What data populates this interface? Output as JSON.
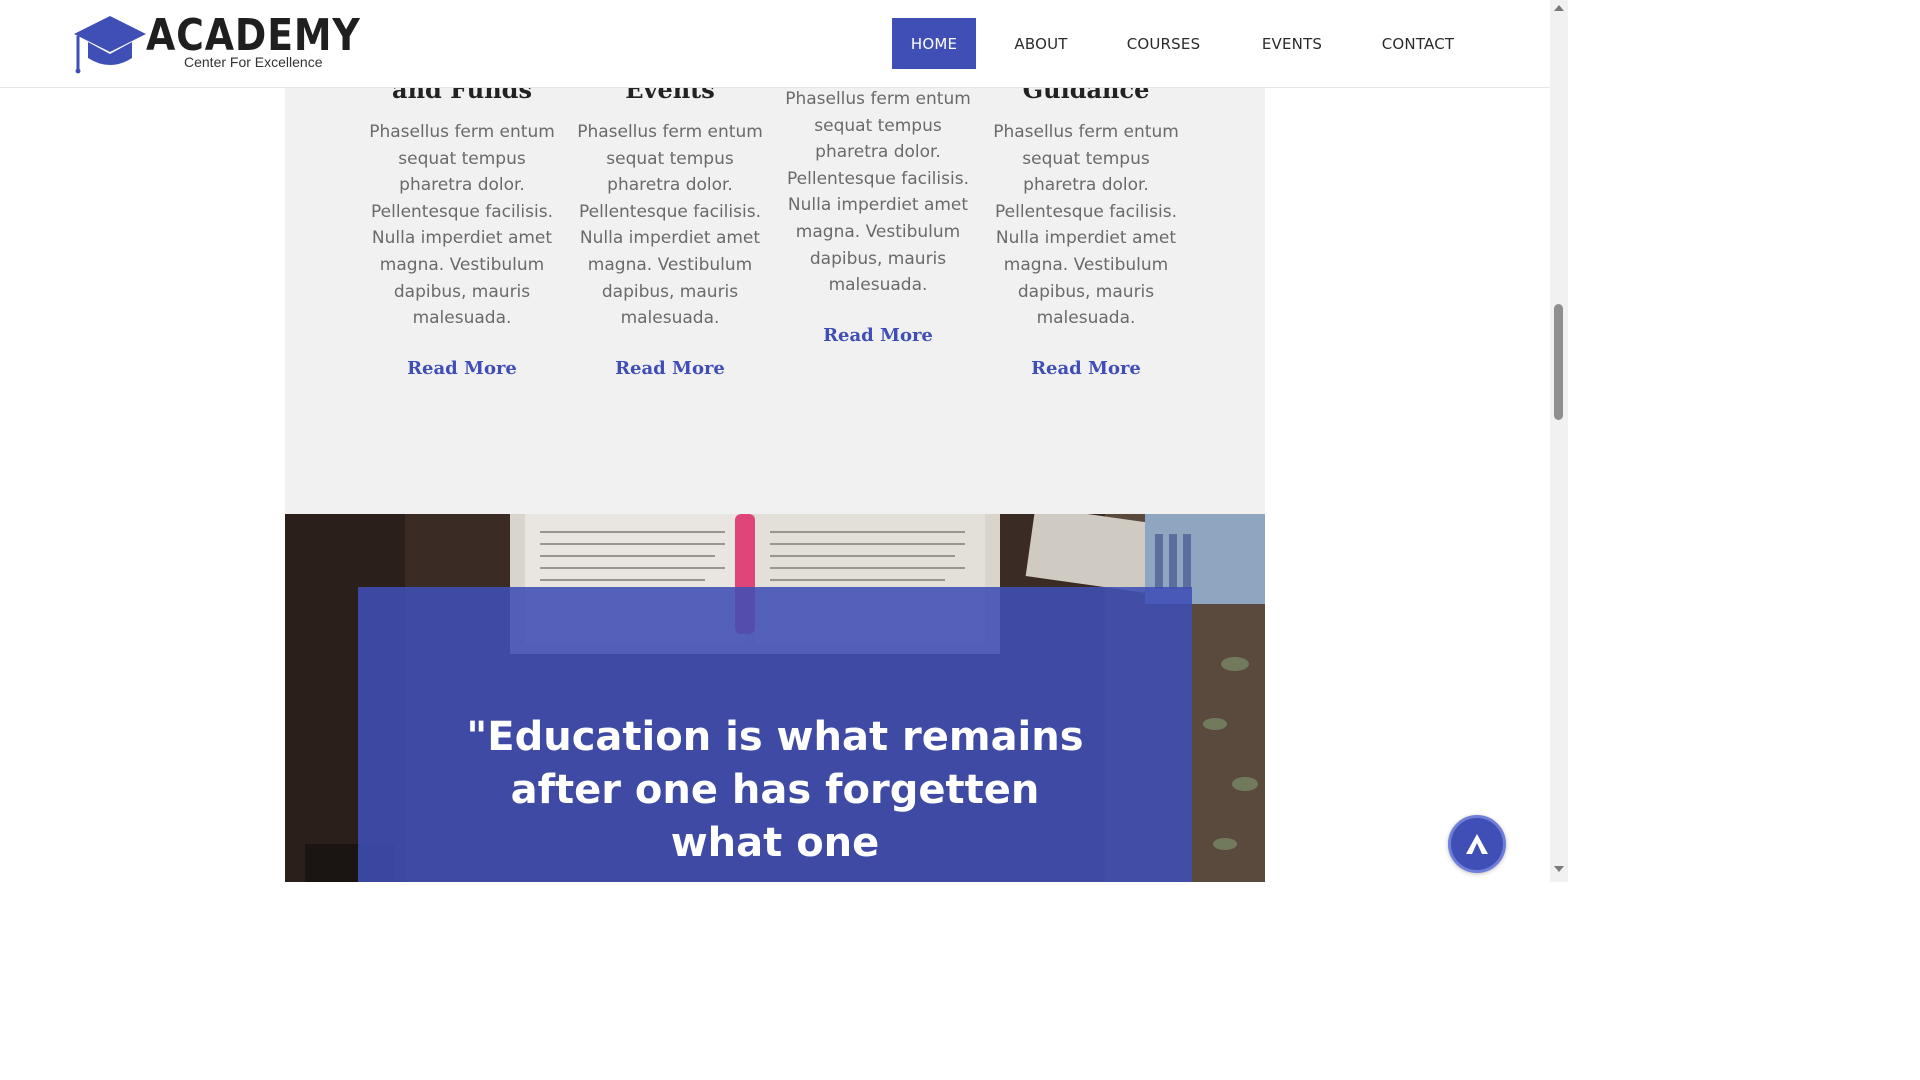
{
  "header": {
    "logo": {
      "wordmark": "ACADEMY",
      "tagline": "Center For Excellence"
    },
    "nav": {
      "home": "HOME",
      "about": "ABOUT",
      "courses": "COURSES",
      "events": "EVENTS",
      "contact": "CONTACT",
      "active": "HOME"
    }
  },
  "features": {
    "items": [
      {
        "title": "and Funds",
        "text": "Phasellus ferm entum sequat tempus pharetra dolor. Pellentesque facilisis. Nulla imperdiet amet magna. Vestibulum dapibus, mauris malesuada.",
        "link": "Read More"
      },
      {
        "title": "Events",
        "text": "Phasellus ferm entum sequat tempus pharetra dolor. Pellentesque facilisis. Nulla imperdiet amet magna. Vestibulum dapibus, mauris malesuada.",
        "link": "Read More"
      },
      {
        "title": "",
        "text": "Phasellus ferm entum sequat tempus pharetra dolor. Pellentesque facilisis. Nulla imperdiet amet magna. Vestibulum dapibus, mauris malesuada.",
        "link": "Read More"
      },
      {
        "title": "Guidance",
        "text": "Phasellus ferm entum sequat tempus pharetra dolor. Pellentesque facilisis. Nulla imperdiet amet magna. Vestibulum dapibus, mauris malesuada.",
        "link": "Read More"
      }
    ]
  },
  "quote": {
    "text": "\"Education is what remains after one has forgetten what one"
  },
  "colors": {
    "accent": "#3f4fb5",
    "section_bg": "#f1f1f1",
    "body_text": "#6a6a6a",
    "heading_text": "#222222"
  },
  "icons": {
    "logo": "graduation-cap-icon",
    "back_to_top": "arrow-up-icon"
  }
}
